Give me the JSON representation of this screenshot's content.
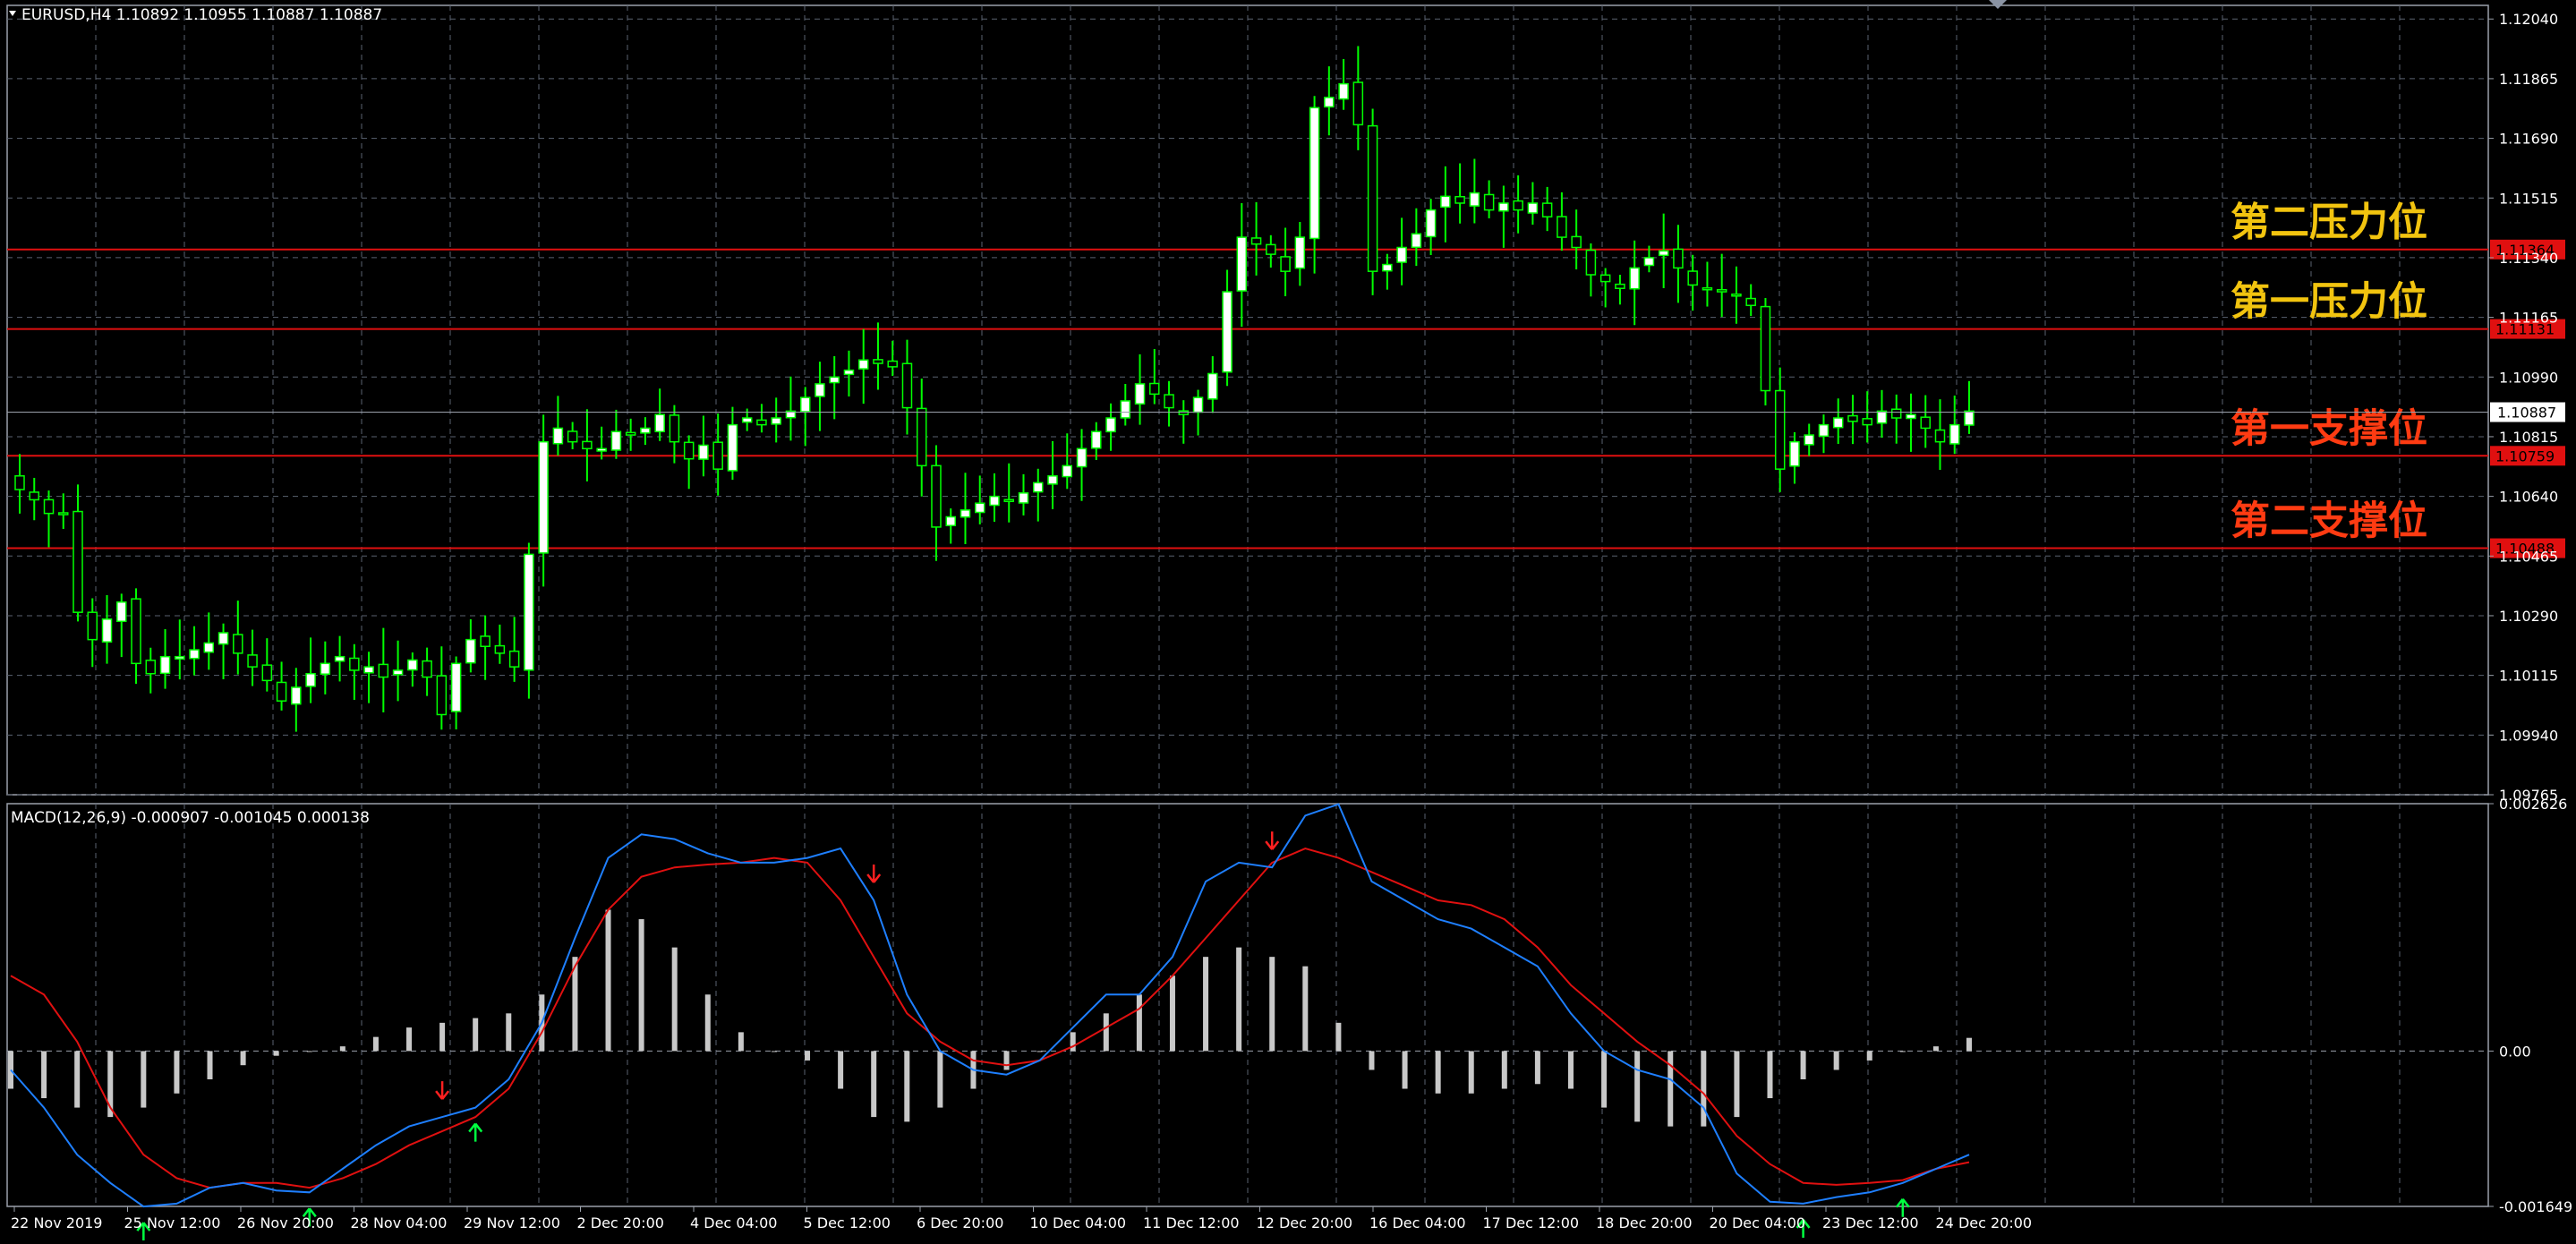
{
  "symbol_header": "EURUSD,H4  1.10892 1.10955 1.10887 1.10887",
  "macd_header": "MACD(12,26,9) -0.000907 -0.001045 0.000138",
  "level_labels": [
    {
      "text": "第二压力位",
      "price": 1.11364,
      "color": "#f2c40f",
      "badge": "1.11364"
    },
    {
      "text": "第一压力位",
      "price": 1.11131,
      "color": "#f2c40f",
      "badge": "1.11131"
    },
    {
      "text": "第一支撑位",
      "price": 1.10759,
      "color": "#ff3b12",
      "badge": "1.10759"
    },
    {
      "text": "第二支撑位",
      "price": 1.10488,
      "color": "#ff3b12",
      "badge": "1.10488"
    }
  ],
  "current_price": "1.10887",
  "colors": {
    "background": "#000000",
    "grid": "#5a6270",
    "axis_text": "#ffffff",
    "candle": "#00ff00",
    "bull_body": "#ffffff",
    "bear_body": "#ffffff",
    "level_line": "#e01010",
    "macd_line": "#1e7fff",
    "signal_line": "#e01010",
    "histogram": "#c8c8c8",
    "arrow_up": "#00ff40",
    "arrow_down": "#ff2020"
  },
  "chart_data": [
    {
      "type": "candlestick",
      "title": "EURUSD,H4",
      "ohlc_last": {
        "open": 1.10892,
        "high": 1.10955,
        "low": 1.10887,
        "close": 1.10887
      },
      "y_ticks": [
        "1.12040",
        "1.11865",
        "1.11690",
        "1.11515",
        "1.11340",
        "1.11165",
        "1.10990",
        "1.10815",
        "1.10640",
        "1.10465",
        "1.10290",
        "1.10115",
        "1.09940",
        "1.09765"
      ],
      "y_range": [
        1.09765,
        1.1208
      ],
      "x_ticks": [
        "22 Nov 2019",
        "25 Nov 12:00",
        "26 Nov 20:00",
        "28 Nov 04:00",
        "29 Nov 12:00",
        "2 Dec 20:00",
        "4 Dec 04:00",
        "5 Dec 12:00",
        "6 Dec 20:00",
        "10 Dec 04:00",
        "11 Dec 12:00",
        "12 Dec 20:00",
        "16 Dec 04:00",
        "17 Dec 12:00",
        "18 Dec 20:00",
        "20 Dec 04:00",
        "23 Dec 12:00",
        "24 Dec 20:00"
      ],
      "levels": [
        1.11364,
        1.11131,
        1.10759,
        1.10488
      ],
      "current_price": 1.10887,
      "close_series": [
        1.1066,
        1.1063,
        1.1059,
        1.1059,
        1.103,
        1.1022,
        1.1028,
        1.1033,
        1.1015,
        1.1012,
        1.1017,
        1.1017,
        1.1019,
        1.1021,
        1.1024,
        1.1018,
        1.1014,
        1.101,
        1.1004,
        1.1008,
        1.1012,
        1.1015,
        1.1017,
        1.1013,
        1.1014,
        1.1011,
        1.1013,
        1.1016,
        1.1011,
        1.1,
        1.1015,
        1.1022,
        1.102,
        1.1018,
        1.1014,
        1.1047,
        1.108,
        1.1084,
        1.108,
        1.1078,
        1.1078,
        1.1083,
        1.1082,
        1.1084,
        1.1088,
        1.108,
        1.1075,
        1.1079,
        1.1072,
        1.1085,
        1.1087,
        1.1085,
        1.1087,
        1.1089,
        1.1093,
        1.1097,
        1.1099,
        1.1101,
        1.1104,
        1.1103,
        1.1102,
        1.109,
        1.1073,
        1.1055,
        1.1058,
        1.106,
        1.1062,
        1.1064,
        1.1063,
        1.1065,
        1.1068,
        1.107,
        1.1073,
        1.1078,
        1.1083,
        1.1087,
        1.1092,
        1.1097,
        1.1094,
        1.109,
        1.1088,
        1.1093,
        1.11,
        1.1124,
        1.114,
        1.1138,
        1.1135,
        1.113,
        1.114,
        1.1178,
        1.1181,
        1.1185,
        1.1173,
        1.113,
        1.1132,
        1.1137,
        1.1141,
        1.1148,
        1.1152,
        1.115,
        1.1153,
        1.1148,
        1.115,
        1.1148,
        1.115,
        1.1146,
        1.114,
        1.1137,
        1.1129,
        1.1127,
        1.1125,
        1.1131,
        1.1134,
        1.1136,
        1.1131,
        1.1126,
        1.1125,
        1.1124,
        1.1123,
        1.112,
        1.1095,
        1.1072,
        1.108,
        1.1082,
        1.1085,
        1.1087,
        1.1086,
        1.1085,
        1.1089,
        1.1087,
        1.1088,
        1.1084,
        1.108,
        1.1085,
        1.1089
      ],
      "high_annotations": {
        "max_high": 1.12035,
        "min_low": 1.0985
      }
    },
    {
      "type": "macd",
      "title": "MACD(12,26,9)",
      "params": [
        12,
        26,
        9
      ],
      "values": {
        "main": -0.000907,
        "signal": -0.001045,
        "histogram": 0.000138
      },
      "y_ticks": [
        "0.002626",
        "0.00",
        "-0.001649"
      ],
      "y_range": [
        -0.001649,
        0.002626
      ],
      "series": [
        {
          "name": "main",
          "values": [
            -0.0002,
            -0.0006,
            -0.0011,
            -0.0014,
            -0.00165,
            -0.00162,
            -0.00145,
            -0.0014,
            -0.00148,
            -0.0015,
            -0.00125,
            -0.001,
            -0.0008,
            -0.0007,
            -0.0006,
            -0.0003,
            0.0003,
            0.0012,
            0.00205,
            0.0023,
            0.00225,
            0.0021,
            0.002,
            0.002,
            0.00205,
            0.00215,
            0.0016,
            0.0006,
            0.0,
            -0.0002,
            -0.00025,
            -0.0001,
            0.00025,
            0.0006,
            0.0006,
            0.001,
            0.0018,
            0.002,
            0.00195,
            0.0025,
            0.00262,
            0.0018,
            0.0016,
            0.0014,
            0.0013,
            0.0011,
            0.0009,
            0.0004,
            0.0,
            -0.0002,
            -0.0003,
            -0.0006,
            -0.0013,
            -0.0016,
            -0.00162,
            -0.00155,
            -0.0015,
            -0.0014,
            -0.00125,
            -0.0011
          ]
        },
        {
          "name": "signal",
          "values": [
            0.0008,
            0.0006,
            0.0001,
            -0.0006,
            -0.0011,
            -0.00135,
            -0.00145,
            -0.0014,
            -0.0014,
            -0.00145,
            -0.00135,
            -0.0012,
            -0.001,
            -0.00085,
            -0.0007,
            -0.0004,
            0.0002,
            0.0009,
            0.0015,
            0.00185,
            0.00195,
            0.00198,
            0.002,
            0.00205,
            0.002,
            0.0016,
            0.001,
            0.0004,
            0.0001,
            -0.0001,
            -0.00015,
            -0.0001,
            5e-05,
            0.00025,
            0.00045,
            0.0008,
            0.0012,
            0.0016,
            0.002,
            0.00215,
            0.00205,
            0.0019,
            0.00175,
            0.0016,
            0.00155,
            0.0014,
            0.0011,
            0.0007,
            0.0004,
            0.0001,
            -0.00015,
            -0.00045,
            -0.0009,
            -0.0012,
            -0.0014,
            -0.00142,
            -0.0014,
            -0.00137,
            -0.00125,
            -0.00118
          ]
        },
        {
          "name": "histogram",
          "values": [
            -0.0004,
            -0.0005,
            -0.0006,
            -0.0007,
            -0.0006,
            -0.00045,
            -0.0003,
            -0.00015,
            -5e-05,
            0.0,
            5e-05,
            0.00015,
            0.00025,
            0.0003,
            0.00035,
            0.0004,
            0.0006,
            0.001,
            0.0015,
            0.0014,
            0.0011,
            0.0006,
            0.0002,
            0.0,
            -0.0001,
            -0.0004,
            -0.0007,
            -0.00075,
            -0.0006,
            -0.0004,
            -0.0002,
            0.0,
            0.0002,
            0.0004,
            0.0006,
            0.0008,
            0.001,
            0.0011,
            0.001,
            0.0009,
            0.0003,
            -0.0002,
            -0.0004,
            -0.00045,
            -0.00045,
            -0.0004,
            -0.00035,
            -0.0004,
            -0.0006,
            -0.00075,
            -0.0008,
            -0.0008,
            -0.0007,
            -0.0005,
            -0.0003,
            -0.0002,
            -0.0001,
            0.0,
            5e-05,
            0.00014
          ]
        }
      ],
      "signals": [
        {
          "dir": "up",
          "index": 4
        },
        {
          "dir": "up",
          "index": 9
        },
        {
          "dir": "down",
          "index": 13
        },
        {
          "dir": "up",
          "index": 14
        },
        {
          "dir": "down",
          "index": 26
        },
        {
          "dir": "down",
          "index": 38
        },
        {
          "dir": "up",
          "index": 54
        },
        {
          "dir": "up",
          "index": 57
        }
      ]
    }
  ]
}
